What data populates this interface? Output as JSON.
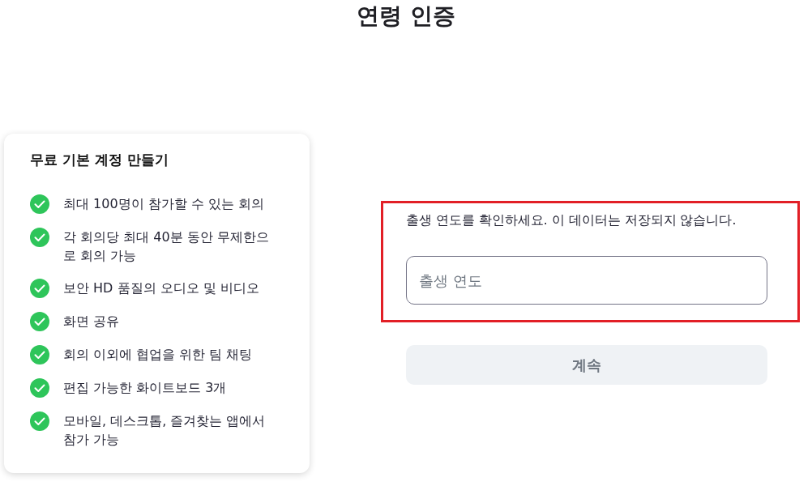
{
  "page": {
    "title": "연령 인증"
  },
  "plan_card": {
    "title": "무료 기본 계정 만들기",
    "features": [
      "최대 100명이 참가할 수 있는 회의",
      "각 회의당 최대 40분 동안 무제한으로 회의 가능",
      "보안 HD 품질의 오디오 및 비디오",
      "화면 공유",
      "회의 이외에 협업을 위한 팀 채팅",
      "편집 가능한 화이트보드 3개",
      "모바일, 데스크톱, 즐겨찾는 앱에서 참가 가능"
    ]
  },
  "age_form": {
    "highlighted": true,
    "prompt": "출생 연도를 확인하세요. 이 데이터는 저장되지 않습니다.",
    "birth_year_field": {
      "placeholder": "출생 연도"
    },
    "continue_button": {
      "label": "계속",
      "disabled": true
    }
  }
}
